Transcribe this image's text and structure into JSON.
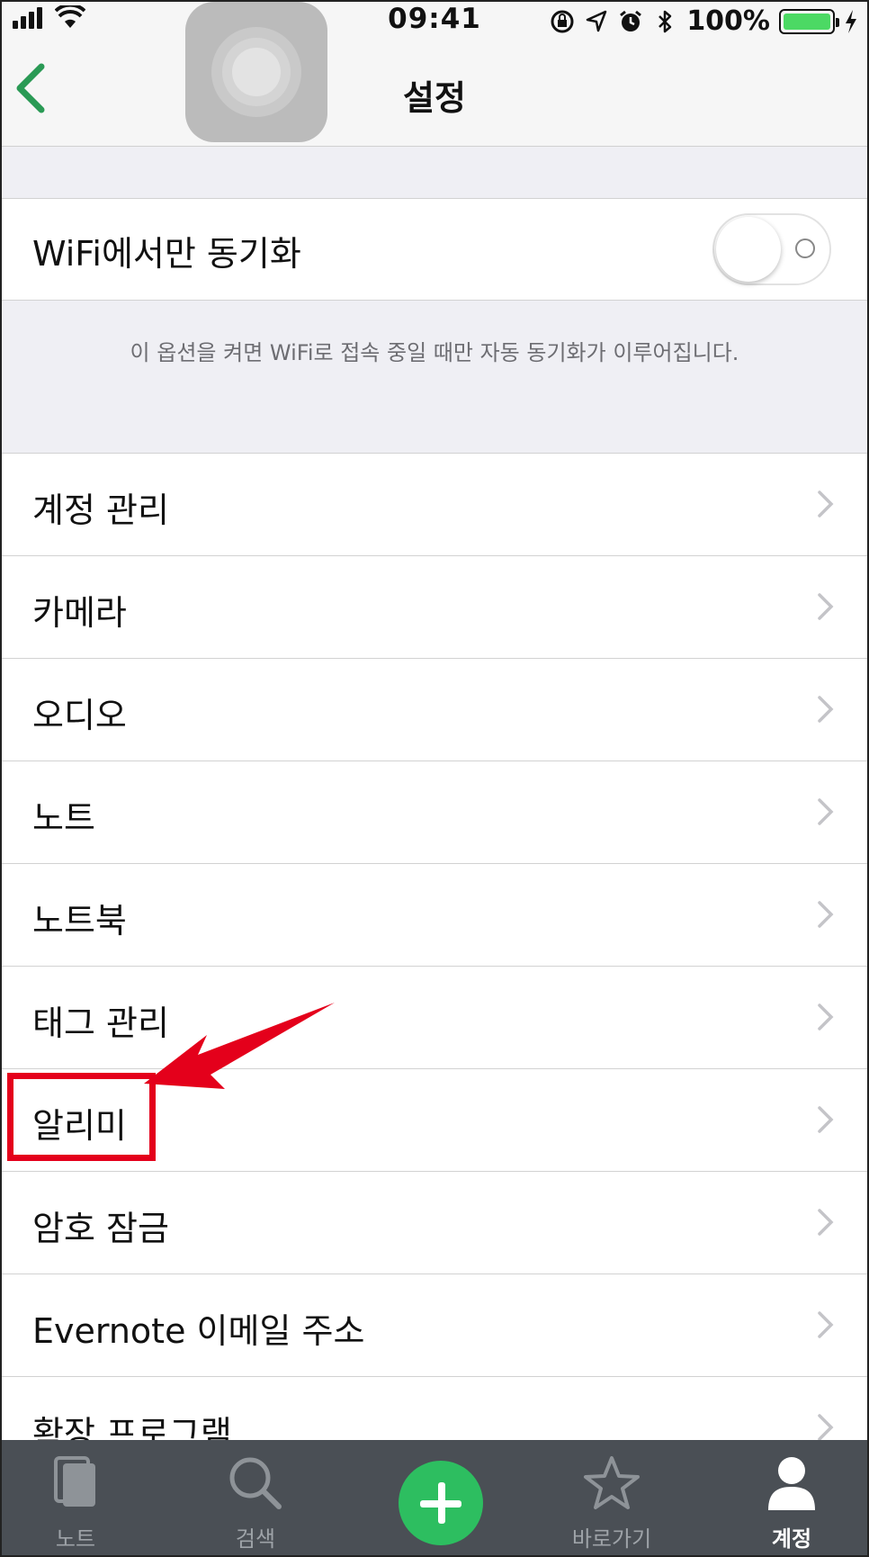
{
  "status_bar": {
    "time": "09:41",
    "battery_percent": "100%",
    "battery_level": 1.0
  },
  "nav": {
    "title": "설정",
    "back_icon": "chevron-left-icon",
    "accent_color": "#2dbe60"
  },
  "wifi_sync": {
    "label": "WiFi에서만 동기화",
    "enabled": false,
    "footer": "이 옵션을 켜면 WiFi로 접속 중일 때만 자동 동기화가 이루어집니다."
  },
  "settings": {
    "items": [
      {
        "label": "계정 관리"
      },
      {
        "label": "카메라"
      },
      {
        "label": "오디오"
      },
      {
        "label": "노트"
      },
      {
        "label": "노트북"
      },
      {
        "label": "태그 관리"
      },
      {
        "label": "알리미"
      },
      {
        "label": "암호 잠금"
      },
      {
        "label": "Evernote 이메일 주소"
      },
      {
        "label": "확장 프로그램"
      }
    ]
  },
  "annotation": {
    "color": "#e4001b",
    "target": "알리미"
  },
  "tabbar": {
    "tabs": [
      {
        "label": "노트",
        "icon": "note-icon",
        "active": false
      },
      {
        "label": "검색",
        "icon": "search-icon",
        "active": false
      },
      {
        "label": "",
        "icon": "plus-icon",
        "active": false
      },
      {
        "label": "바로가기",
        "icon": "star-icon",
        "active": false
      },
      {
        "label": "계정",
        "icon": "person-icon",
        "active": true
      }
    ]
  }
}
